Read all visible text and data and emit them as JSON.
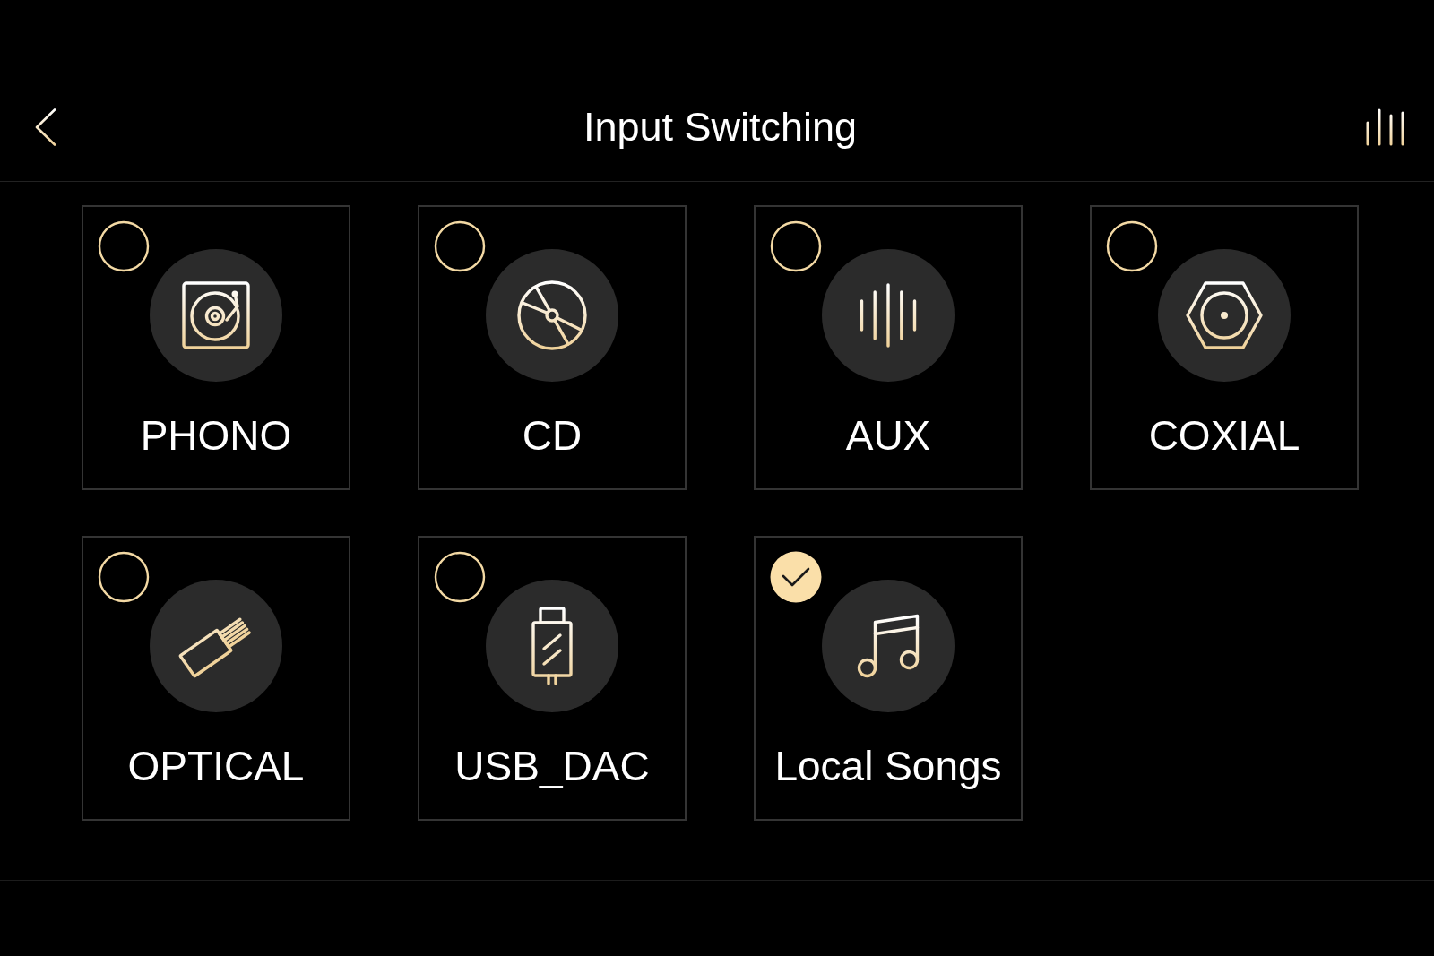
{
  "header": {
    "title": "Input Switching"
  },
  "inputs": [
    {
      "label": "PHONO",
      "selected": false
    },
    {
      "label": "CD",
      "selected": false
    },
    {
      "label": "AUX",
      "selected": false
    },
    {
      "label": "COXIAL",
      "selected": false
    },
    {
      "label": "OPTICAL",
      "selected": false
    },
    {
      "label": "USB_DAC",
      "selected": false
    },
    {
      "label": "Local Songs",
      "selected": true
    }
  ]
}
